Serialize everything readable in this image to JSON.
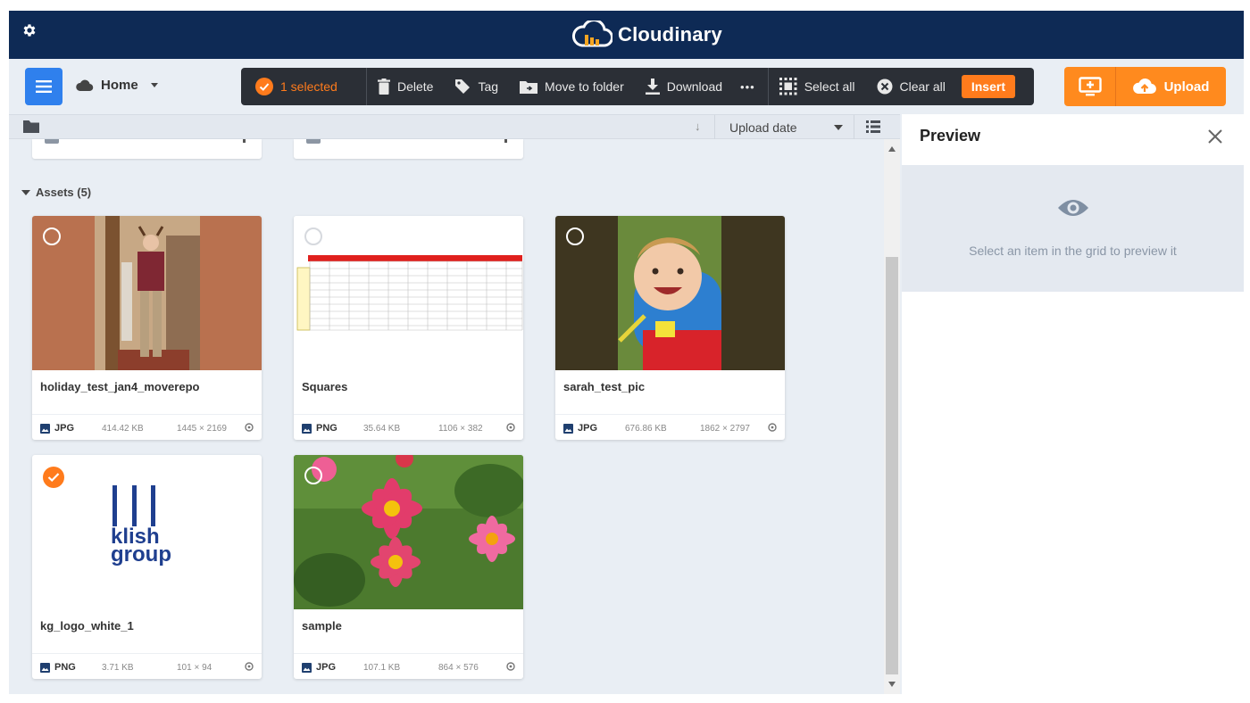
{
  "brand": {
    "name": "Cloudinary"
  },
  "toolbar": {
    "home_label": "Home",
    "selected_label": "1 selected",
    "delete_label": "Delete",
    "tag_label": "Tag",
    "move_label": "Move to folder",
    "download_label": "Download",
    "more_label": "•••",
    "select_all_label": "Select all",
    "clear_all_label": "Clear all",
    "insert_label": "Insert",
    "upload_label": "Upload"
  },
  "sort": {
    "arrow": "↓",
    "field": "Upload date"
  },
  "assets": {
    "heading": "Assets (5)",
    "items": [
      {
        "name": "holiday_test_jan4_moverepo",
        "type": "JPG",
        "size": "414.42 KB",
        "dims": "1445 × 2169",
        "selected": false
      },
      {
        "name": "Squares",
        "type": "PNG",
        "size": "35.64 KB",
        "dims": "1106 × 382",
        "selected": false
      },
      {
        "name": "sarah_test_pic",
        "type": "JPG",
        "size": "676.86 KB",
        "dims": "1862 × 2797",
        "selected": false
      },
      {
        "name": "kg_logo_white_1",
        "type": "PNG",
        "size": "3.71 KB",
        "dims": "101 × 94",
        "selected": true
      },
      {
        "name": "sample",
        "type": "JPG",
        "size": "107.1 KB",
        "dims": "864 × 576",
        "selected": false
      }
    ]
  },
  "logo_text": {
    "line1": "klish",
    "line2": "group"
  },
  "preview": {
    "title": "Preview",
    "empty_message": "Select an item in the grid to preview it"
  },
  "colors": {
    "header_bg": "#0e2a55",
    "accent_orange": "#ff7b1c",
    "menu_blue": "#2f80ed",
    "actionbar_bg": "#2b2f36",
    "logo_blue": "#1f3f8f"
  }
}
